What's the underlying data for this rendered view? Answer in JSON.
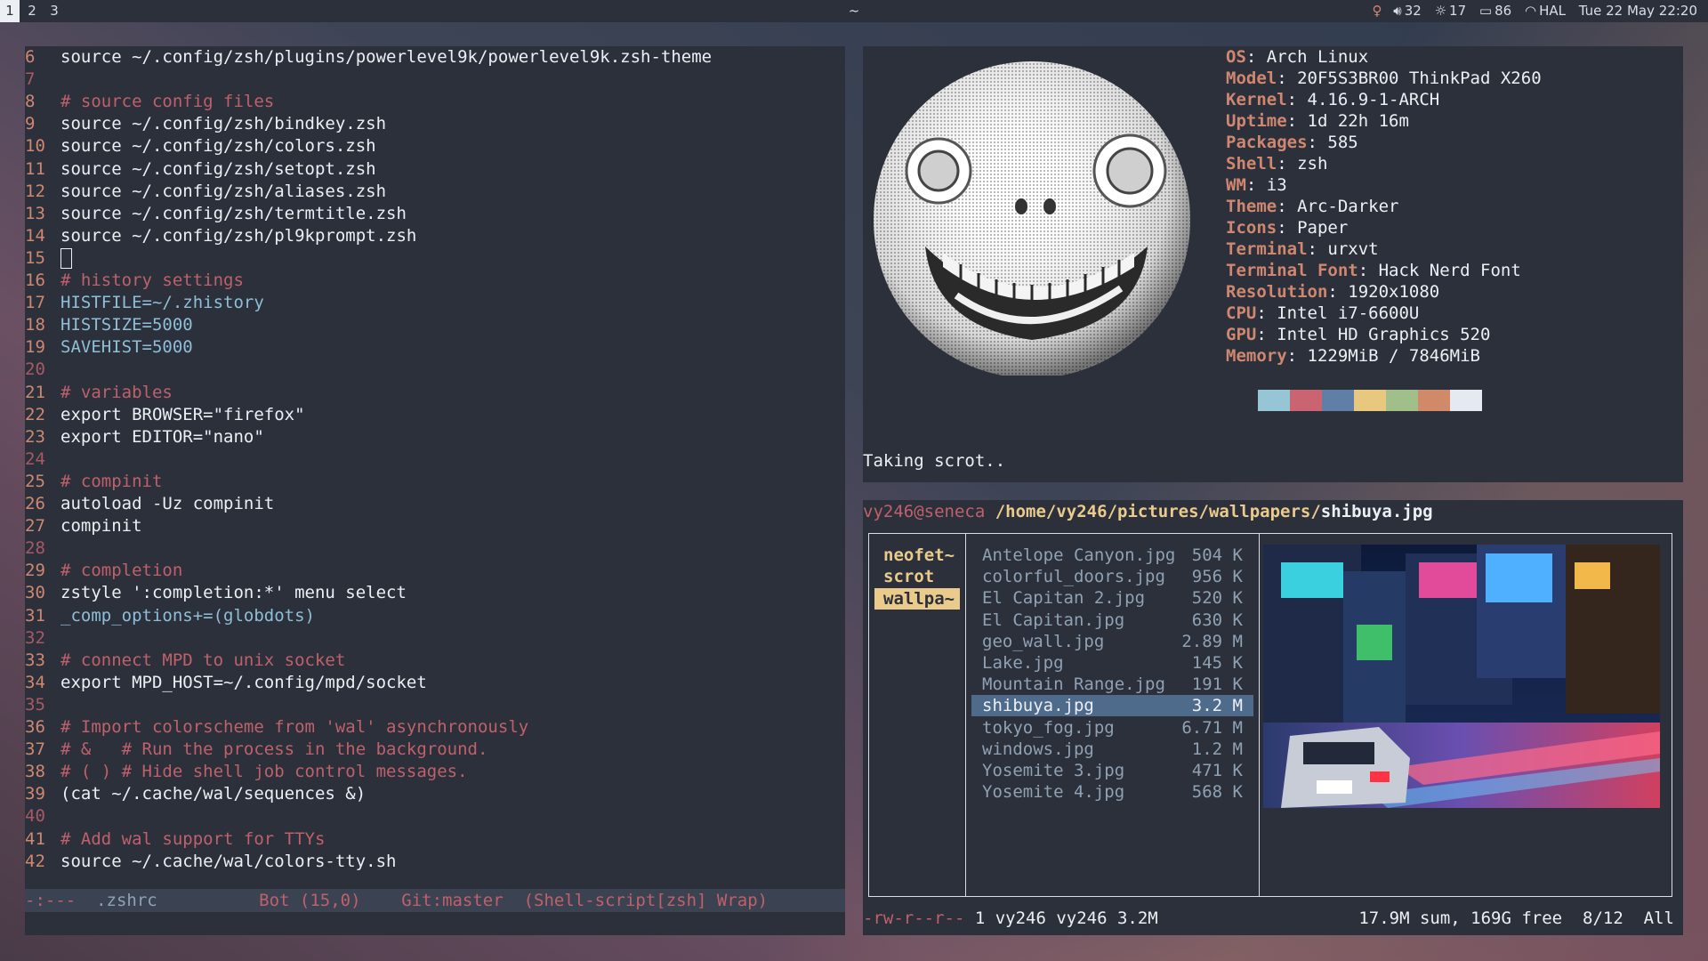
{
  "topbar": {
    "workspaces": [
      "1",
      "2",
      "3"
    ],
    "active_workspace": "1",
    "title": "~",
    "status": {
      "brightness_icon": "bulb-icon",
      "volume": "32",
      "brightness": "17",
      "battery": "86",
      "wifi": "HAL",
      "datetime": "Tue 22 May  22:20"
    }
  },
  "editor": {
    "lines": [
      {
        "n": "6",
        "text": "source ~/.config/zsh/plugins/powerlevel9k/powerlevel9k.zsh-theme",
        "kind": "cmd"
      },
      {
        "n": "7",
        "text": "",
        "kind": "blank"
      },
      {
        "n": "8",
        "text": "# source config files",
        "kind": "comment"
      },
      {
        "n": "9",
        "text": "source ~/.config/zsh/bindkey.zsh",
        "kind": "cmd"
      },
      {
        "n": "10",
        "text": "source ~/.config/zsh/colors.zsh",
        "kind": "cmd"
      },
      {
        "n": "11",
        "text": "source ~/.config/zsh/setopt.zsh",
        "kind": "cmd"
      },
      {
        "n": "12",
        "text": "source ~/.config/zsh/aliases.zsh",
        "kind": "cmd"
      },
      {
        "n": "13",
        "text": "source ~/.config/zsh/termtitle.zsh",
        "kind": "cmd"
      },
      {
        "n": "14",
        "text": "source ~/.config/zsh/pl9kprompt.zsh",
        "kind": "cmd"
      },
      {
        "n": "15",
        "text": "",
        "kind": "cursor"
      },
      {
        "n": "16",
        "text": "# history settings",
        "kind": "comment"
      },
      {
        "n": "17",
        "text": "HISTFILE=~/.zhistory",
        "kind": "assign"
      },
      {
        "n": "18",
        "text": "HISTSIZE=5000",
        "kind": "assign"
      },
      {
        "n": "19",
        "text": "SAVEHIST=5000",
        "kind": "assign"
      },
      {
        "n": "20",
        "text": "",
        "kind": "blank"
      },
      {
        "n": "21",
        "text": "# variables",
        "kind": "comment"
      },
      {
        "n": "22",
        "text": "export BROWSER=\"firefox\"",
        "kind": "export"
      },
      {
        "n": "23",
        "text": "export EDITOR=\"nano\"",
        "kind": "export"
      },
      {
        "n": "24",
        "text": "",
        "kind": "blank"
      },
      {
        "n": "25",
        "text": "# compinit",
        "kind": "comment"
      },
      {
        "n": "26",
        "text": "autoload -Uz compinit",
        "kind": "cmd"
      },
      {
        "n": "27",
        "text": "compinit",
        "kind": "plain"
      },
      {
        "n": "28",
        "text": "",
        "kind": "blank"
      },
      {
        "n": "29",
        "text": "# completion",
        "kind": "comment"
      },
      {
        "n": "30",
        "text": "zstyle ':completion:*' menu select",
        "kind": "zstyle"
      },
      {
        "n": "31",
        "text": "_comp_options+=(globdots)",
        "kind": "assign"
      },
      {
        "n": "32",
        "text": "",
        "kind": "blank"
      },
      {
        "n": "33",
        "text": "# connect MPD to unix socket",
        "kind": "comment"
      },
      {
        "n": "34",
        "text": "export MPD_HOST=~/.config/mpd/socket",
        "kind": "export"
      },
      {
        "n": "35",
        "text": "",
        "kind": "blank"
      },
      {
        "n": "36",
        "text": "# Import colorscheme from 'wal' asynchronously",
        "kind": "comment"
      },
      {
        "n": "37",
        "text": "# &   # Run the process in the background.",
        "kind": "comment"
      },
      {
        "n": "38",
        "text": "# ( ) # Hide shell job control messages.",
        "kind": "comment"
      },
      {
        "n": "39",
        "text": "(cat ~/.cache/wal/sequences &)",
        "kind": "plain"
      },
      {
        "n": "40",
        "text": "",
        "kind": "blank"
      },
      {
        "n": "41",
        "text": "# Add wal support for TTYs",
        "kind": "comment"
      },
      {
        "n": "42",
        "text": "source ~/.cache/wal/colors-tty.sh",
        "kind": "cmd"
      }
    ],
    "modeline": {
      "state": "-:---",
      "buffer": ".zshrc",
      "position": "Bot (15,0)",
      "git": "Git:master",
      "mode": "(Shell-script[zsh] Wrap)"
    }
  },
  "neofetch": {
    "image_icon": "moon-face-icon",
    "info": [
      {
        "key": "OS",
        "value": "Arch Linux"
      },
      {
        "key": "Model",
        "value": "20F5S3BR00 ThinkPad X260"
      },
      {
        "key": "Kernel",
        "value": "4.16.9-1-ARCH"
      },
      {
        "key": "Uptime",
        "value": "1d 22h 16m"
      },
      {
        "key": "Packages",
        "value": "585"
      },
      {
        "key": "Shell",
        "value": "zsh"
      },
      {
        "key": "WM",
        "value": "i3"
      },
      {
        "key": "Theme",
        "value": "Arc-Darker"
      },
      {
        "key": "Icons",
        "value": "Paper"
      },
      {
        "key": "Terminal",
        "value": "urxvt"
      },
      {
        "key": "Terminal Font",
        "value": "Hack Nerd Font"
      },
      {
        "key": "Resolution",
        "value": "1920x1080"
      },
      {
        "key": "CPU",
        "value": "Intel i7-6600U"
      },
      {
        "key": "GPU",
        "value": "Intel HD Graphics 520"
      },
      {
        "key": "Memory",
        "value": "1229MiB / 7846MiB"
      }
    ],
    "colors": [
      "#96c6d6",
      "#c96470",
      "#5f7fa6",
      "#e8c77e",
      "#a1bf8a",
      "#d08a6a",
      "#e5e9f0"
    ],
    "message": "Taking scrot.."
  },
  "ranger": {
    "user_host": "vy246@seneca",
    "dir": "/home/vy246/pictures/wallpapers/",
    "file": "shibuya.jpg",
    "parent_dirs": [
      "neofet~",
      "scrot",
      "wallpa~"
    ],
    "selected_parent": 2,
    "files": [
      {
        "name": "Antelope Canyon.jpg",
        "size": "504 K"
      },
      {
        "name": "colorful_doors.jpg",
        "size": "956 K"
      },
      {
        "name": "El Capitan 2.jpg",
        "size": "520 K"
      },
      {
        "name": "El Capitan.jpg",
        "size": "630 K"
      },
      {
        "name": "geo_wall.jpg",
        "size": "2.89 M"
      },
      {
        "name": "Lake.jpg",
        "size": "145 K"
      },
      {
        "name": "Mountain Range.jpg",
        "size": "191 K"
      },
      {
        "name": "shibuya.jpg",
        "size": "3.2 M"
      },
      {
        "name": "tokyo_fog.jpg",
        "size": "6.71 M"
      },
      {
        "name": "windows.jpg",
        "size": "1.2 M"
      },
      {
        "name": "Yosemite 3.jpg",
        "size": "471 K"
      },
      {
        "name": "Yosemite 4.jpg",
        "size": "568 K"
      }
    ],
    "selected_file": 7,
    "preview_icon": "city-night-photo-icon",
    "status": {
      "perms": "-rw-r--r--",
      "info": "1 vy246 vy246 3.2M",
      "summary": "17.9M sum, 169G free",
      "position": "8/12",
      "scroll": "All"
    }
  }
}
